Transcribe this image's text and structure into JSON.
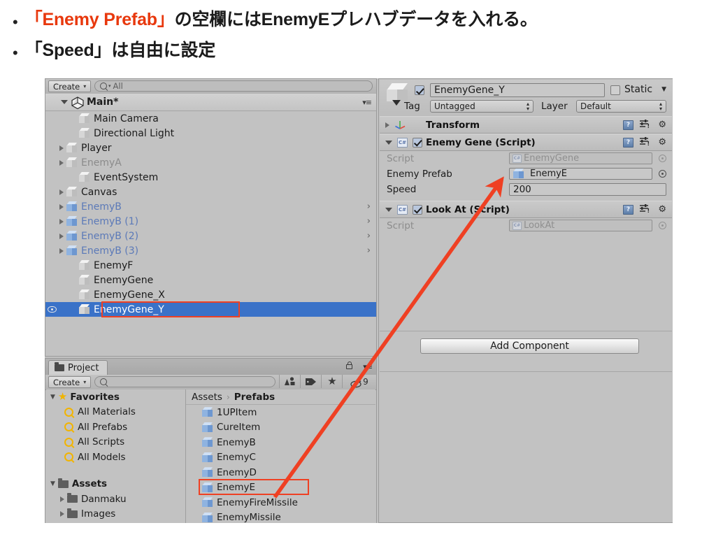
{
  "slide": {
    "bullets": [
      {
        "marker": "•",
        "segments": [
          {
            "text": "「Enemy Prefab」",
            "color": "#e8380d"
          },
          {
            "text": "の空欄にはEnemyEプレハブデータを入れる。",
            "color": "#1b1b1b"
          }
        ]
      },
      {
        "marker": "•",
        "segments": [
          {
            "text": "「Speed」は自由に設定",
            "color": "#1b1b1b"
          }
        ]
      }
    ],
    "bullet1_red": "「Enemy Prefab」",
    "bullet1_rest": "の空欄にはEnemyEプレハブデータを入れる。",
    "bullet2_text": "「Speed」は自由に設定",
    "bullet_marker": "•"
  },
  "hierarchy": {
    "create_label": "Create",
    "create_caret": "▾",
    "search_value": "All",
    "search_icon": "search-icon",
    "scene_name": "Main*",
    "menu_icon": "▾≡",
    "items": [
      {
        "label": "Main Camera",
        "indent": 2,
        "twisty": "none",
        "style": "normal",
        "cube": "white",
        "overflow": false
      },
      {
        "label": "Directional Light",
        "indent": 2,
        "twisty": "none",
        "style": "normal",
        "cube": "white",
        "overflow": false
      },
      {
        "label": "Player",
        "indent": 1,
        "twisty": "right",
        "style": "normal",
        "cube": "white",
        "overflow": false
      },
      {
        "label": "EnemyA",
        "indent": 1,
        "twisty": "right",
        "style": "dim",
        "cube": "white",
        "overflow": false
      },
      {
        "label": "EventSystem",
        "indent": 2,
        "twisty": "none",
        "style": "normal",
        "cube": "white",
        "overflow": false
      },
      {
        "label": "Canvas",
        "indent": 1,
        "twisty": "right",
        "style": "normal",
        "cube": "white",
        "overflow": false
      },
      {
        "label": "EnemyB",
        "indent": 1,
        "twisty": "right",
        "style": "prefab",
        "cube": "blue",
        "overflow": true
      },
      {
        "label": "EnemyB (1)",
        "indent": 1,
        "twisty": "right",
        "style": "prefab",
        "cube": "blue",
        "overflow": true
      },
      {
        "label": "EnemyB (2)",
        "indent": 1,
        "twisty": "right",
        "style": "prefab",
        "cube": "blue",
        "overflow": true
      },
      {
        "label": "EnemyB (3)",
        "indent": 1,
        "twisty": "right",
        "style": "prefab",
        "cube": "blue",
        "overflow": true
      },
      {
        "label": "EnemyF",
        "indent": 2,
        "twisty": "none",
        "style": "normal",
        "cube": "white",
        "overflow": false
      },
      {
        "label": "EnemyGene",
        "indent": 2,
        "twisty": "none",
        "style": "normal",
        "cube": "white",
        "overflow": false
      },
      {
        "label": "EnemyGene_X",
        "indent": 2,
        "twisty": "none",
        "style": "normal",
        "cube": "white",
        "overflow": false
      },
      {
        "label": "EnemyGene_Y",
        "indent": 2,
        "twisty": "none",
        "style": "selected",
        "cube": "white",
        "overflow": false
      }
    ],
    "chevron": "›"
  },
  "inspector": {
    "object_name": "EnemyGene_Y",
    "enabled_checked": true,
    "static_label": "Static",
    "static_checked": false,
    "static_caret": "▼",
    "tag_label": "Tag",
    "tag_value": "Untagged",
    "layer_label": "Layer",
    "layer_value": "Default",
    "stepper_glyph": "▴\n▾",
    "components": [
      {
        "title": "Transform",
        "icon": "transform-axis-icon",
        "expanded": false,
        "has_enable_checkbox": false,
        "rows": []
      },
      {
        "title": "Enemy Gene (Script)",
        "icon": "csharp-script-icon",
        "expanded": true,
        "has_enable_checkbox": true,
        "enabled": true,
        "rows": [
          {
            "label": "Script",
            "value": "EnemyGene",
            "kind": "object-readonly",
            "icon": "csharp-mini-icon"
          },
          {
            "label": "Enemy Prefab",
            "value": "EnemyE",
            "kind": "object",
            "icon": "prefab-cube-icon"
          },
          {
            "label": "Speed",
            "value": "200",
            "kind": "text"
          }
        ]
      },
      {
        "title": "Look At (Script)",
        "icon": "csharp-script-icon",
        "expanded": true,
        "has_enable_checkbox": true,
        "enabled": true,
        "rows": [
          {
            "label": "Script",
            "value": "LookAt",
            "kind": "object-readonly",
            "icon": "csharp-mini-icon"
          }
        ]
      }
    ],
    "add_component_label": "Add Component",
    "help_icon": "help-book-icon",
    "preset_icon": "preset-icon",
    "gear_icon": "gear-icon",
    "csharp_badge": "C#"
  },
  "project": {
    "tab_label": "Project",
    "tab_icon": "folder-icon",
    "lock_icon": "lock-open-icon",
    "menu_icon": "▾≡",
    "create_label": "Create",
    "create_caret": "▾",
    "search_value": "",
    "toolbar_icons": [
      "shape-filter-icon",
      "label-filter-icon",
      "favorite-star-icon",
      "hidden-eye-icon"
    ],
    "hidden_count": "9",
    "favorites": {
      "label": "Favorites",
      "twisty": "▼",
      "items": [
        "All Materials",
        "All Prefabs",
        "All Scripts",
        "All Models"
      ]
    },
    "assets": {
      "label": "Assets",
      "twisty": "▼",
      "items": [
        "Danmaku",
        "Images"
      ]
    },
    "breadcrumb": {
      "root": "Assets",
      "sep": "›",
      "current": "Prefabs"
    },
    "asset_items": [
      {
        "label": "1UPItem",
        "highlighted": false
      },
      {
        "label": "CureItem",
        "highlighted": false
      },
      {
        "label": "EnemyB",
        "highlighted": false
      },
      {
        "label": "EnemyC",
        "highlighted": false
      },
      {
        "label": "EnemyD",
        "highlighted": false
      },
      {
        "label": "EnemyE",
        "highlighted": true
      },
      {
        "label": "EnemyFireMissile",
        "highlighted": false
      },
      {
        "label": "EnemyMissile",
        "highlighted": false
      }
    ]
  },
  "annotations": {
    "highlight_color": "#ef4023",
    "arrow_color": "#ef4023",
    "arrow_from": "EnemyE",
    "arrow_to": "Enemy Prefab"
  },
  "colors": {
    "selection_blue": "#3a72c8",
    "panel_gray": "#c2c2c2",
    "prefab_blue_text": "#5b79b8",
    "red_accent": "#e8380d"
  }
}
